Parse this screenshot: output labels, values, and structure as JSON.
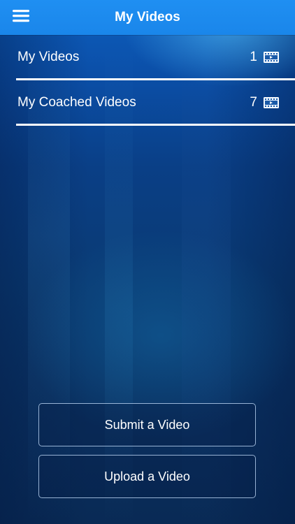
{
  "navbar": {
    "title": "My Videos",
    "menu_icon": "hamburger-menu-icon"
  },
  "list": {
    "items": [
      {
        "label": "My Videos",
        "count": "1",
        "icon": "film-strip-icon"
      },
      {
        "label": "My Coached Videos",
        "count": "7",
        "icon": "film-strip-icon"
      }
    ]
  },
  "actions": {
    "submit_label": "Submit a Video",
    "upload_label": "Upload a Video"
  },
  "colors": {
    "navbar": "#1f8ff2",
    "background_top": "#0d5fbf",
    "background_bottom": "#092a55",
    "text": "#ffffff"
  }
}
